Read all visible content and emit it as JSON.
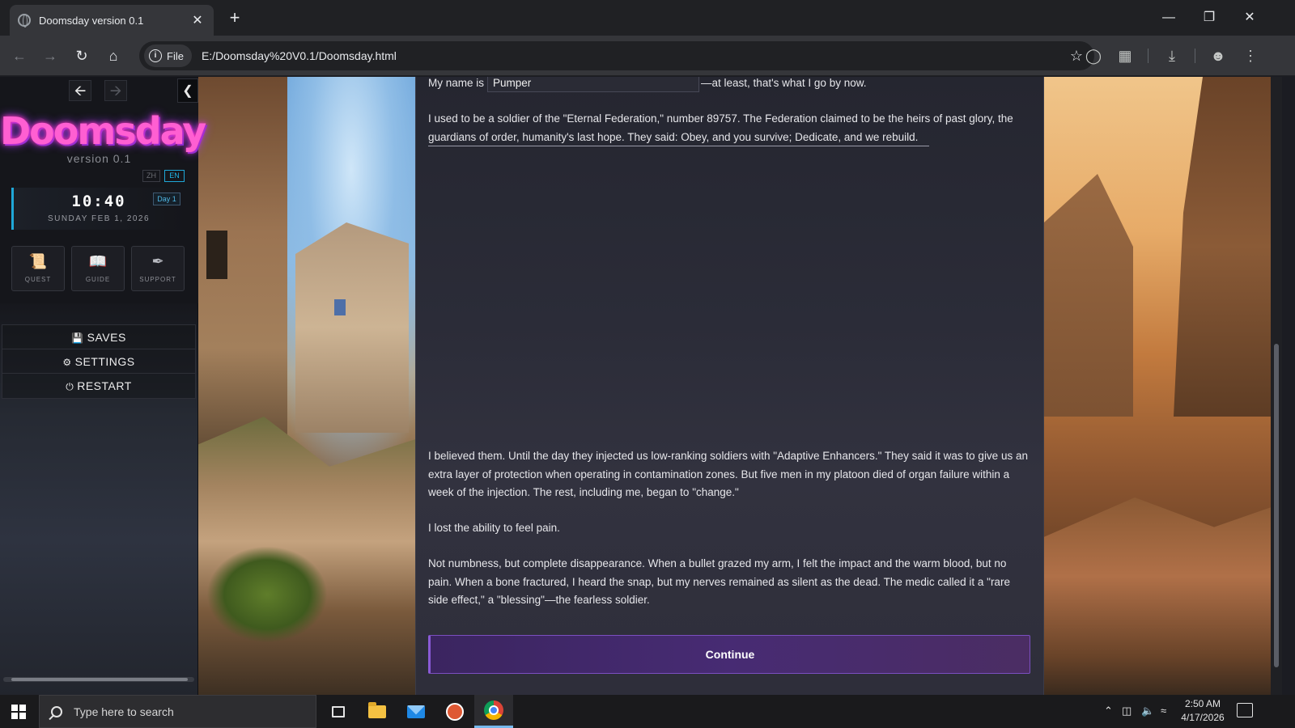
{
  "browser": {
    "tab_title": "Doomsday version 0.1",
    "tab_close": "✕",
    "new_tab": "+",
    "url_chip": "File",
    "url": "E:/Doomsday%20V0.1/Doomsday.html"
  },
  "game": {
    "logo": "Doomsday",
    "version": "version 0.1",
    "languages": [
      "ZH",
      "EN"
    ],
    "active_language": "EN",
    "clock": {
      "time": "10:40",
      "date": "SUNDAY FEB 1, 2026",
      "day": "Day 1"
    },
    "menu_tiles": [
      {
        "label": "QUEST",
        "icon": "scroll-icon"
      },
      {
        "label": "GUIDE",
        "icon": "book-icon"
      },
      {
        "label": "SUPPORT",
        "icon": "quill-icon"
      }
    ],
    "system_menu": [
      {
        "label": "SAVES",
        "icon": "save-icon"
      },
      {
        "label": "SETTINGS",
        "icon": "gear-icon"
      },
      {
        "label": "RESTART",
        "icon": "power-icon"
      }
    ]
  },
  "story": {
    "name_prefix": "My name is",
    "name_value": "Pumper",
    "name_suffix": "—at least, that's what I go by now.",
    "paragraphs": [
      "I used to be a soldier of the \"Eternal Federation,\" number 89757. The Federation claimed to be the heirs of past glory, the guardians of order, humanity's last hope. They said: Obey, and you survive; Dedicate, and we rebuild.",
      "I believed them. Until the day they injected us low-ranking soldiers with \"Adaptive Enhancers.\" They said it was to give us an extra layer of protection when operating in contamination zones. But five men in my platoon died of organ failure within a week of the injection. The rest, including me, began to \"change.\"",
      "I lost the ability to feel pain.",
      "Not numbness, but complete disappearance. When a bullet grazed my arm, I felt the impact and the warm blood, but no pain. When a bone fractured, I heard the snap, but my nerves remained as silent as the dead. The medic called it a \"rare side effect,\" a \"blessing\"—the fearless soldier."
    ],
    "continue_label": "Continue"
  },
  "taskbar": {
    "search_placeholder": "Type here to search",
    "time": "2:50 AM",
    "date": "4/17/2026"
  }
}
